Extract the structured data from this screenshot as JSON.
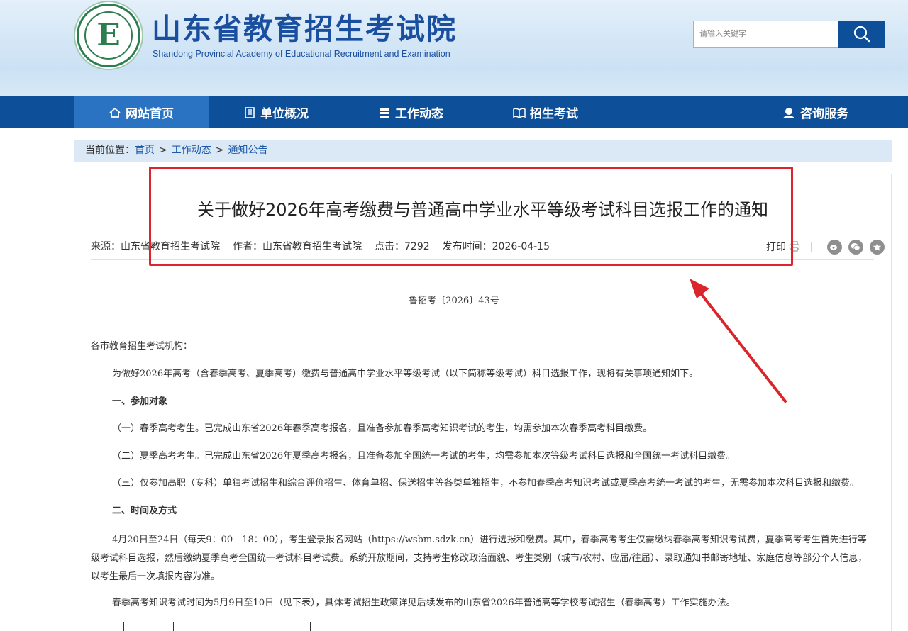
{
  "header": {
    "logo_cn": "山东省教育招生考试院",
    "logo_en": "Shandong Provincial Academy of Educational Recruitment and Examination",
    "logo_icon": "academy-seal-logo",
    "search": {
      "placeholder": "请输入关键字",
      "icon": "search-icon"
    }
  },
  "nav": {
    "items": [
      {
        "label": "网站首页",
        "icon": "home-icon",
        "active": true
      },
      {
        "label": "单位概况",
        "icon": "building-icon",
        "active": false
      },
      {
        "label": "工作动态",
        "icon": "list-icon",
        "active": false
      },
      {
        "label": "招生考试",
        "icon": "book-icon",
        "active": false
      },
      {
        "label": "",
        "icon": "",
        "active": false
      },
      {
        "label": "咨询服务",
        "icon": "user-service-icon",
        "active": false
      }
    ]
  },
  "breadcrumb": {
    "prefix": "当前位置：",
    "items": [
      "首页",
      "工作动态",
      "通知公告"
    ],
    "separator": ">"
  },
  "article": {
    "title": "关于做好2026年高考缴费与普通高中学业水平等级考试科目选报工作的通知",
    "source": "来源：山东省教育招生考试院",
    "author": "作者：山东省教育招生考试院",
    "clicks": "点击：7292",
    "date": "发布时间：2026-04-15",
    "tools": {
      "print": "打印",
      "separator": "|",
      "icons": [
        "print-icon",
        "weibo-icon",
        "wechat-icon",
        "favorite-icon"
      ]
    },
    "doc_number": "鲁招考〔2026〕43号",
    "salutation": "各市教育招生考试机构：",
    "intro": "为做好2026年高考（含春季高考、夏季高考）缴费与普通高中学业水平等级考试（以下简称等级考试）科目选报工作，现将有关事项通知如下。",
    "section1_title": "一、参加对象",
    "item1": "（一）春季高考考生。已完成山东省2026年春季高考报名，且准备参加春季高考知识考试的考生，均需参加本次春季高考科目缴费。",
    "item2": "（二）夏季高考考生。已完成山东省2026年夏季高考报名，且准备参加全国统一考试的考生，均需参加本次等级考试科目选报和全国统一考试科目缴费。",
    "item3": "（三）仅参加高职（专科）单独考试招生和综合评价招生、体育单招、保送招生等各类单独招生，不参加春季高考知识考试或夏季高考统一考试的考生，无需参加本次科目选报和缴费。",
    "section2_title": "二、时间及方式",
    "para_time": "4月20日至24日（每天9：00—18：00），考生登录报名网站（https://wsbm.sdzk.cn）进行选报和缴费。其中，春季高考考生仅需缴纳春季高考知识考试费，夏季高考考生首先进行等级考试科目选报，然后缴纳夏季高考全国统一考试科目考试费。系统开放期间，支持考生修改政治面貌、考生类别（城市/农村、应届/往届）、录取通知书邮寄地址、家庭信息等部分个人信息，以考生最后一次填报内容为准。",
    "para_spring": "春季高考知识考试时间为5月9日至10日（见下表），具体考试招生政策详见后续发布的山东省2026年普通高等学校考试招生（春季高考）工作实施办法。"
  },
  "colors": {
    "nav_bg": "#0d4f99",
    "nav_active": "#2a73c2",
    "breadcrumb_bg": "#dbe9f7",
    "link": "#1e5aa8",
    "annotation": "#d9252b"
  }
}
